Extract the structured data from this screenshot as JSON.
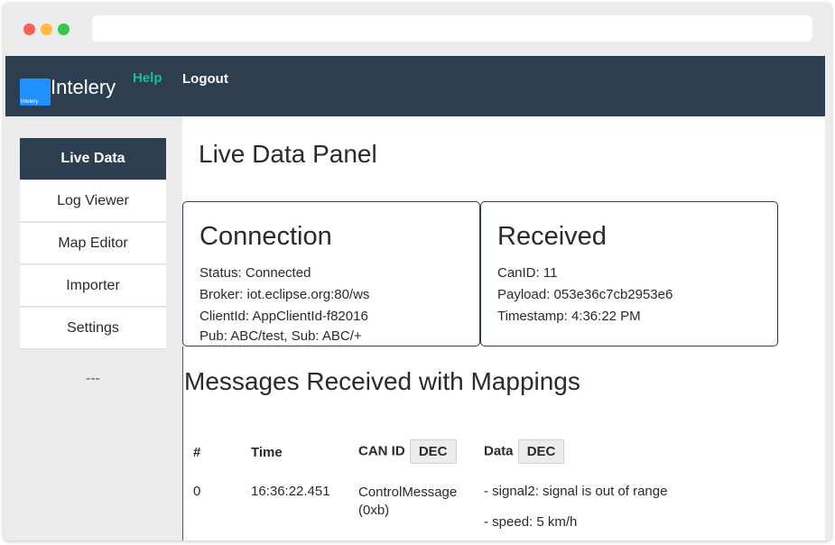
{
  "browser": {
    "address": ""
  },
  "navbar": {
    "logo_text": "intelery",
    "brand": "Intelery",
    "links": [
      {
        "label": "Help",
        "color": "#18bc9c"
      },
      {
        "label": "Logout"
      }
    ],
    "background": "#2c3e50"
  },
  "sidebar": {
    "items": [
      {
        "label": "Live Data",
        "active": true
      },
      {
        "label": "Log Viewer"
      },
      {
        "label": "Map Editor"
      },
      {
        "label": "Importer"
      },
      {
        "label": "Settings"
      }
    ],
    "extra": "---"
  },
  "main": {
    "title": "Live Data Panel",
    "connection": {
      "title": "Connection",
      "status": "Status: Connected",
      "broker": "Broker: iot.eclipse.org:80/ws",
      "client_id": "ClientId: AppClientId-f82016",
      "pubsub": "Pub: ABC/test, Sub: ABC/+"
    },
    "received": {
      "title": "Received",
      "can_id": "CanID: 11",
      "payload": "Payload: 053e36c7cb2953e6",
      "timestamp": "Timestamp: 4:36:22 PM"
    },
    "messages": {
      "title": "Messages Received with Mappings",
      "columns": {
        "num": "#",
        "time": "Time",
        "can_id": "CAN ID",
        "data": "Data",
        "dec": "DEC"
      },
      "rows": [
        {
          "num": "0",
          "time": "16:36:22.451",
          "can_name": "ControlMessage",
          "can_hex": "(0xb)",
          "signals": [
            "- signal2: signal is out of range",
            "- speed: 5 km/h"
          ]
        }
      ]
    }
  }
}
